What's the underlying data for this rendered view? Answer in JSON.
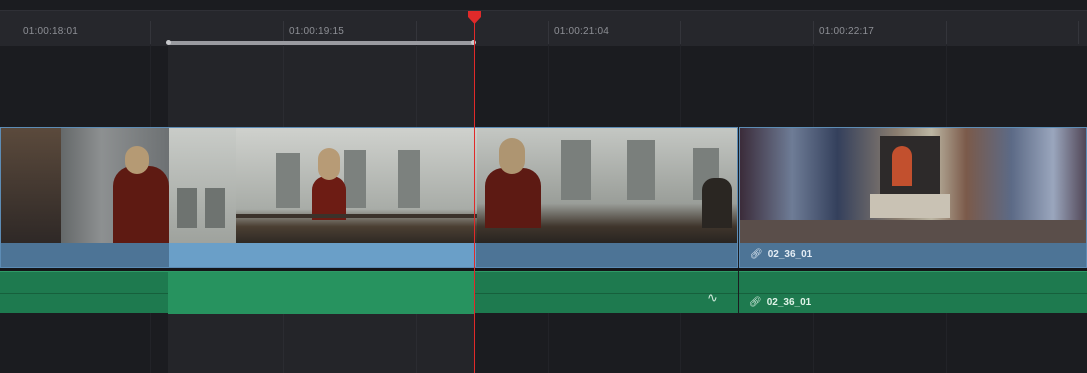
{
  "ruler": {
    "timecodes": [
      "01:00:18:01",
      "01:00:19:15",
      "01:00:21:04",
      "01:00:22:17"
    ]
  },
  "video_track": {
    "clips": [
      {
        "name": "",
        "selected_range": true
      },
      {
        "name": "02_36_01",
        "link_icon": "link-icon"
      }
    ]
  },
  "audio_track": {
    "clips": [
      {
        "name": "",
        "fade_icon": "fade-curve-icon"
      },
      {
        "name": "02_36_01",
        "link_icon": "link-icon"
      }
    ]
  },
  "colors": {
    "playhead": "#e02a2a",
    "video_clip": "#4d7496",
    "video_clip_selected": "#6a9fc8",
    "audio_clip": "#1e7a4f",
    "audio_clip_selected": "#27935f"
  }
}
